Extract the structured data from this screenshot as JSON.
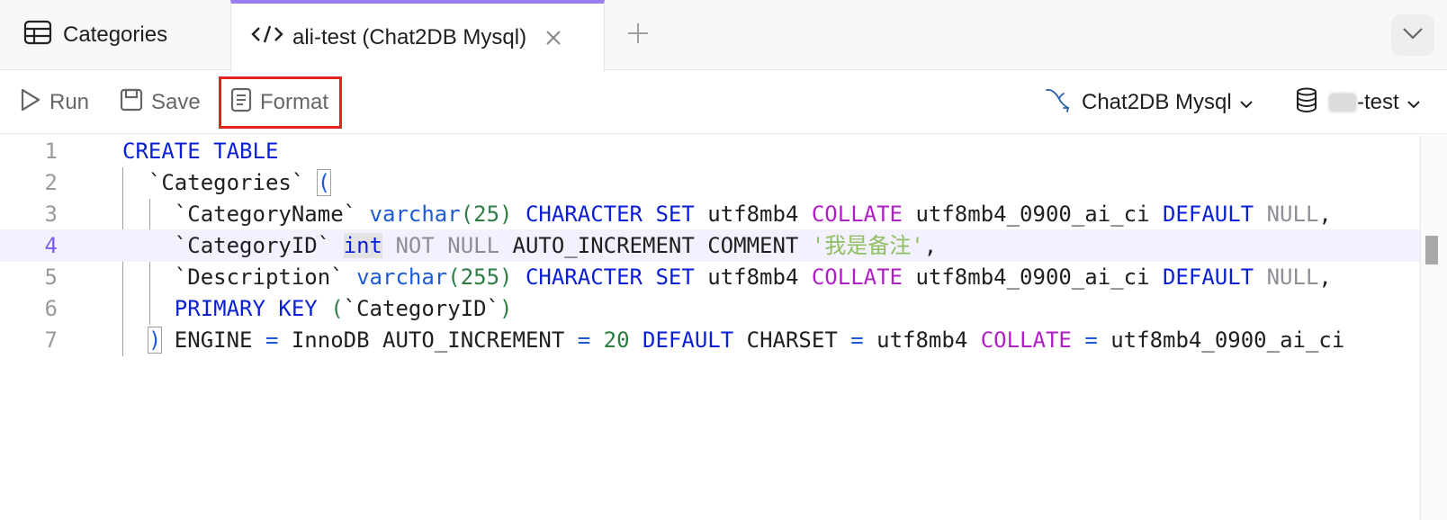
{
  "tabs": {
    "categories_label": "Categories",
    "active_label": "ali-test (Chat2DB Mysql)"
  },
  "toolbar": {
    "run_label": "Run",
    "save_label": "Save",
    "format_label": "Format",
    "database_label": "Chat2DB Mysql",
    "schema_label": "-test"
  },
  "editor": {
    "line_numbers": [
      "1",
      "2",
      "3",
      "4",
      "5",
      "6",
      "7"
    ],
    "current_line": "4",
    "lines": [
      [
        [
          "kw",
          "CREATE TABLE"
        ]
      ],
      [
        [
          "pl",
          "  `Categories` "
        ],
        [
          "dk",
          "("
        ]
      ],
      [
        [
          "pl",
          "    `CategoryName` "
        ],
        [
          "dk",
          "varchar"
        ],
        [
          "nm",
          "(25)"
        ],
        [
          "pl",
          " "
        ],
        [
          "kw",
          "CHARACTER SET"
        ],
        [
          "pl",
          " utf8mb4 "
        ],
        [
          "pk",
          "COLLATE"
        ],
        [
          "pl",
          " utf8mb4_0900_ai_ci "
        ],
        [
          "kw",
          "DEFAULT"
        ],
        [
          "gy",
          " NULL"
        ],
        [
          "pl",
          ","
        ]
      ],
      [
        [
          "pl",
          "    `CategoryID` "
        ],
        [
          "kw",
          "int"
        ],
        [
          "gy",
          " NOT NULL"
        ],
        [
          "pl",
          " AUTO_INCREMENT COMMENT "
        ],
        [
          "st",
          "'我是备注'"
        ],
        [
          "pl",
          ","
        ]
      ],
      [
        [
          "pl",
          "    `Description` "
        ],
        [
          "dk",
          "varchar"
        ],
        [
          "nm",
          "(255)"
        ],
        [
          "pl",
          " "
        ],
        [
          "kw",
          "CHARACTER SET"
        ],
        [
          "pl",
          " utf8mb4 "
        ],
        [
          "pk",
          "COLLATE"
        ],
        [
          "pl",
          " utf8mb4_0900_ai_ci "
        ],
        [
          "kw",
          "DEFAULT"
        ],
        [
          "gy",
          " NULL"
        ],
        [
          "pl",
          ","
        ]
      ],
      [
        [
          "pl",
          "    "
        ],
        [
          "kw",
          "PRIMARY KEY"
        ],
        [
          "pl",
          " "
        ],
        [
          "nm",
          "("
        ],
        [
          "pl",
          "`CategoryID`"
        ],
        [
          "nm",
          ")"
        ]
      ],
      [
        [
          "pl",
          "  "
        ],
        [
          "dk",
          ")"
        ],
        [
          "pl",
          " ENGINE "
        ],
        [
          "dk",
          "="
        ],
        [
          "pl",
          " InnoDB AUTO_INCREMENT "
        ],
        [
          "dk",
          "="
        ],
        [
          "nm",
          " 20"
        ],
        [
          "pl",
          " "
        ],
        [
          "kw",
          "DEFAULT"
        ],
        [
          "pl",
          " CHARSET "
        ],
        [
          "dk",
          "="
        ],
        [
          "pl",
          " utf8mb4 "
        ],
        [
          "pk",
          "COLLATE"
        ],
        [
          "pl",
          " "
        ],
        [
          "dk",
          "="
        ],
        [
          "pl",
          " utf8mb4_0900_ai_ci"
        ]
      ]
    ]
  },
  "colors": {
    "accent": "#9b7bf0",
    "highlight_box": "#e32222",
    "keyword": "#0a1fd6",
    "collate": "#b01fc5",
    "number": "#2e7d45",
    "string": "#8fbf60",
    "muted": "#8c9096"
  }
}
